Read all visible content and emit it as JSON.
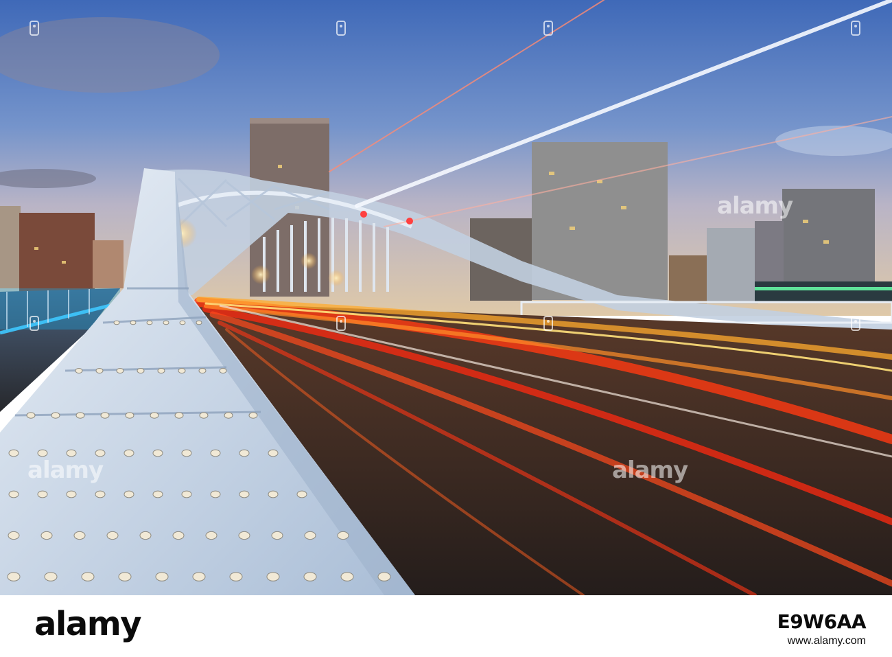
{
  "photo": {
    "subject": "bridge",
    "watermark_text": "alamy"
  },
  "footer": {
    "brand": "alamy",
    "image_id": "E9W6AA",
    "site": "www.alamy.com"
  },
  "colors": {
    "sky_top": "#3f69b8",
    "sky_bottom": "#dfc9a8",
    "road": "#2e2521",
    "steel": "#cfdcea",
    "trail_red": "#ff3a12",
    "trail_orange": "#ffab2e"
  }
}
